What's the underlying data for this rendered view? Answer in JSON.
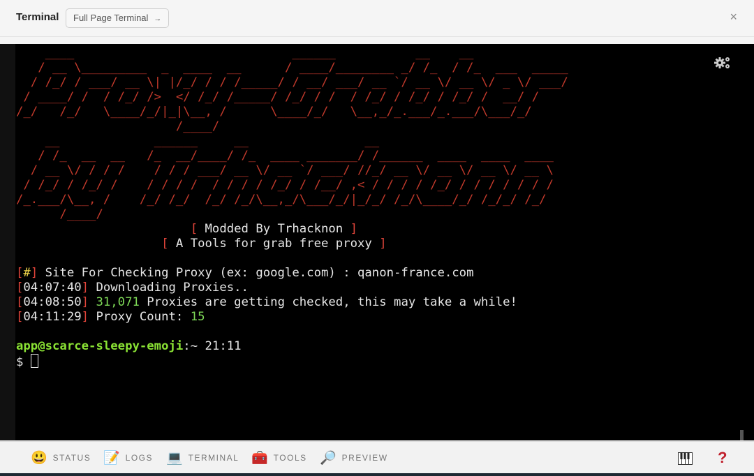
{
  "header": {
    "title": "Terminal",
    "full_page_button": "Full Page Terminal",
    "full_page_arrow": "→",
    "close": "×"
  },
  "terminal": {
    "banner_art": [
      "    ____                              ______           __    __",
      "   / __ \\_________  _  ____  __      / ____/________ _/ /_  / /_  ___  _____",
      "  / /_/ / ___/ __ \\| |/_/ / / /_____/ / __/ ___/ __ `/ __ \\/ __ \\/ _ \\/ ___/",
      " / ____/ /  / /_/ />  </ /_/ /_____/ /_/ / /  / /_/ / /_/ / /_/ /  __/ /",
      "/_/   /_/   \\____/_/|_|\\__, /      \\____/_/   \\__,_/_.___/_.___/\\___/_/",
      "                      /____/",
      "    __             ______     __                __",
      "   / /_  __  __   /_  __/____/ /_  ____ _______/ /______  ____  ____  ____",
      "  / __ \\/ / / /    / / / ___/ __ \\/ __ `/ ___/ //_/ __ \\/ __ \\/ __ \\/ __ \\",
      " / /_/ / /_/ /    / / / /  / / / / /_/ / /__/ ,< / / / / /_/ / / / / / / /",
      "/_.___/\\__, /    /_/ /_/  /_/ /_/\\__,_/\\___/_/|_/_/ /_/\\____/_/ /_/_/ /_/",
      "      /____/"
    ],
    "modded_by": "Modded By Trhacknon",
    "tagline": "A Tools for grab free proxy",
    "site_prompt_mark": "#",
    "site_prompt": " Site For Checking Proxy (ex: google.com) : qanon-france.com",
    "log": [
      {
        "time": "04:07:40",
        "pre": " Downloading Proxies..",
        "num": "",
        "post": ""
      },
      {
        "time": "04:08:50",
        "pre": " ",
        "num": "31,071",
        "post": " Proxies are getting checked, this may take a while!"
      },
      {
        "time": "04:11:29",
        "pre": " Proxy Count: ",
        "num": "15",
        "post": ""
      }
    ],
    "prompt_user": "app@scarce-sleepy-emoji",
    "prompt_rest": ":~ 21:11",
    "shell_symbol": "$ "
  },
  "bottom_tabs": [
    {
      "icon": "😃",
      "label": "STATUS"
    },
    {
      "icon": "📝",
      "label": "LOGS"
    },
    {
      "icon": "💻",
      "label": "TERMINAL"
    },
    {
      "icon": "🧰",
      "label": "TOOLS"
    },
    {
      "icon": "🔎",
      "label": "PREVIEW"
    }
  ],
  "help": "?",
  "colors": {
    "art": "#c0392b",
    "bracket": "#e0443a",
    "number": "#7ed957",
    "prompt": "#8ae234",
    "help": "#c0202c"
  }
}
